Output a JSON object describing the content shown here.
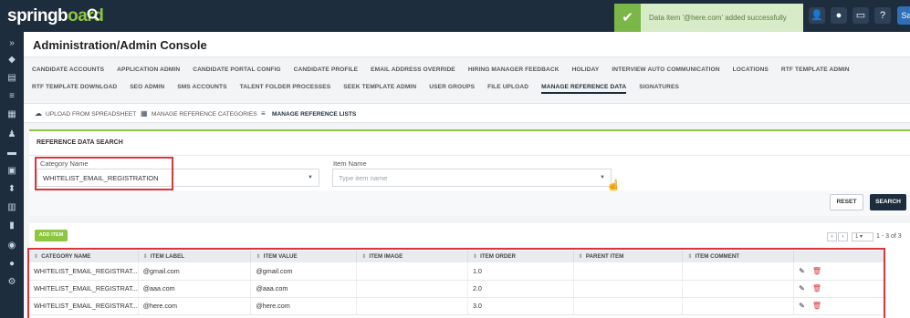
{
  "topbar": {
    "logo_main": "springb",
    "logo_accent": "oard",
    "toast_message": "Data item '@here.com' added successfully",
    "user_initials": "Sa"
  },
  "page": {
    "title": "Administration/Admin Console"
  },
  "nav": {
    "row1": [
      "CANDIDATE ACCOUNTS",
      "APPLICATION ADMIN",
      "CANDIDATE PORTAL CONFIG",
      "CANDIDATE PROFILE",
      "EMAIL ADDRESS OVERRIDE",
      "HIRING MANAGER FEEDBACK",
      "HOLIDAY",
      "INTERVIEW AUTO COMMUNICATION",
      "LOCATIONS",
      "RTF TEMPLATE ADMIN"
    ],
    "row2": [
      "RTF TEMPLATE DOWNLOAD",
      "SEO ADMIN",
      "SMS ACCOUNTS",
      "TALENT FOLDER PROCESSES",
      "SEEK TEMPLATE ADMIN",
      "USER GROUPS",
      "FILE UPLOAD",
      "MANAGE REFERENCE DATA",
      "SIGNATURES"
    ],
    "active": "MANAGE REFERENCE DATA"
  },
  "subtabs": {
    "upload": "UPLOAD FROM SPREADSHEET",
    "categories": "MANAGE REFERENCE CATEGORIES",
    "lists": "MANAGE REFERENCE LISTS"
  },
  "search": {
    "title": "REFERENCE DATA SEARCH",
    "category_label": "Category Name",
    "category_value": "WHITELIST_EMAIL_REGISTRATION",
    "item_label": "Item Name",
    "item_placeholder": "Type item name",
    "reset_label": "RESET",
    "search_label": "SEARCH"
  },
  "results": {
    "add_label": "ADD ITEM",
    "pager_page": "1",
    "pager_range": "1 - 3 of 3",
    "columns": [
      "CATEGORY NAME",
      "ITEM LABEL",
      "ITEM VALUE",
      "ITEM IMAGE",
      "ITEM ORDER",
      "PARENT ITEM",
      "ITEM COMMENT"
    ],
    "rows": [
      {
        "category": "WHITELIST_EMAIL_REGISTRAT...",
        "label": "@gmail.com",
        "value": "@gmail.com",
        "image": "",
        "order": "1.0",
        "parent": "",
        "comment": ""
      },
      {
        "category": "WHITELIST_EMAIL_REGISTRAT...",
        "label": "@aaa.com",
        "value": "@aaa.com",
        "image": "",
        "order": "2.0",
        "parent": "",
        "comment": ""
      },
      {
        "category": "WHITELIST_EMAIL_REGISTRAT...",
        "label": "@here.com",
        "value": "@here.com",
        "image": "",
        "order": "3.0",
        "parent": "",
        "comment": ""
      }
    ]
  },
  "colors": {
    "brand_dark": "#1d2d3d",
    "accent_green": "#8dc63f",
    "highlight_red": "#d9363e"
  },
  "icons": [
    "search-icon",
    "check-icon",
    "user-icon",
    "notification-icon",
    "window-icon",
    "help-icon",
    "upload-icon",
    "table-icon",
    "list-icon",
    "edit-icon",
    "delete-icon",
    "caret-down-icon"
  ]
}
